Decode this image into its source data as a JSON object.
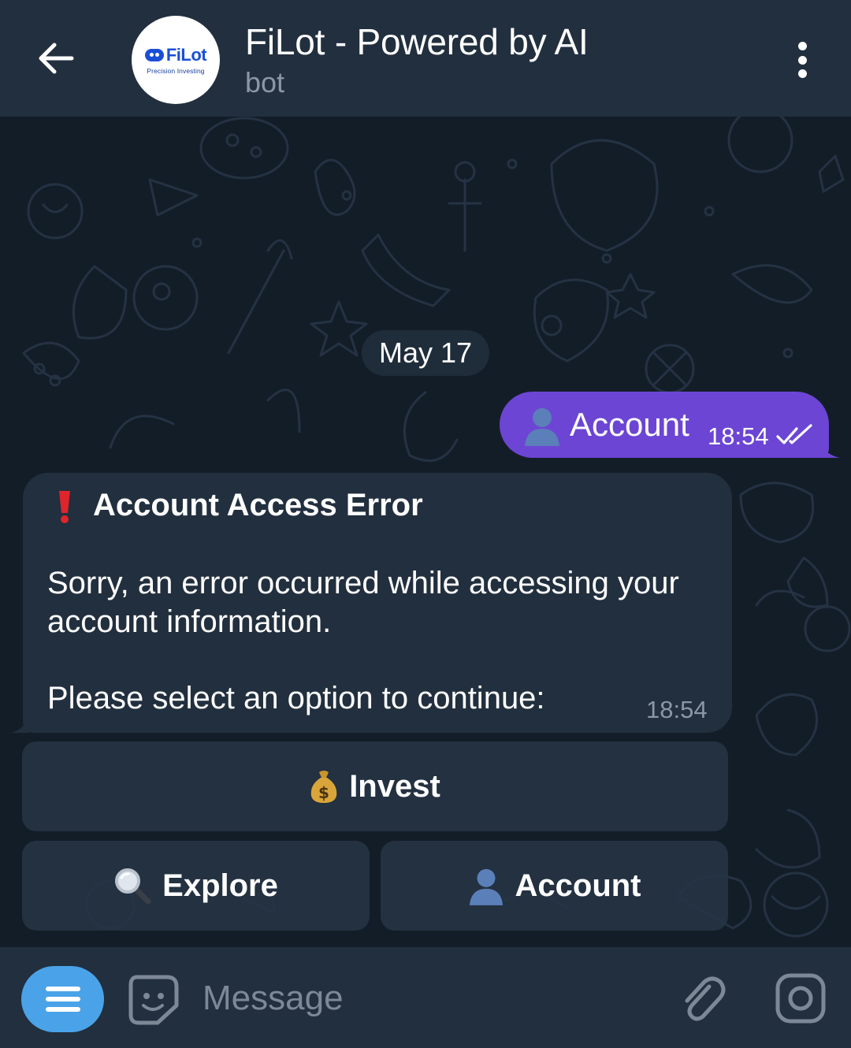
{
  "header": {
    "back_icon": "arrow-left-icon",
    "logo_text": "FiLot",
    "logo_tagline": "Precision Investing",
    "title": "FiLot - Powered by AI",
    "subtitle": "bot",
    "more_icon": "kebab-menu-icon"
  },
  "chat": {
    "date_chip": "May 17",
    "outgoing": {
      "icon": "bust-silhouette-icon",
      "text": "Account",
      "time": "18:54",
      "status_icon": "double-check-icon"
    },
    "incoming": {
      "title_icon": "red-exclamation-icon",
      "title": "Account Access Error",
      "body": "Sorry, an error occurred while accessing your account information.",
      "prompt": "Please select an option to continue:",
      "time": "18:54"
    },
    "keyboard": [
      {
        "label": "Invest",
        "icon": "money-bag-icon"
      },
      {
        "label": "Explore",
        "icon": "magnifier-icon"
      },
      {
        "label": "Account",
        "icon": "bust-silhouette-icon"
      }
    ]
  },
  "input_bar": {
    "menu_icon": "hamburger-icon",
    "emoji_icon": "sticker-smile-icon",
    "placeholder": "Message",
    "attach_icon": "paperclip-icon",
    "camera_icon": "camera-icon"
  },
  "colors": {
    "header_bg": "#222f3e",
    "wallpaper_bg": "#131d28",
    "outgoing_bubble": "#6c45d4",
    "incoming_bubble": "#222f3e",
    "menu_button": "#4aa3e8",
    "error_accent": "#e0242b"
  }
}
